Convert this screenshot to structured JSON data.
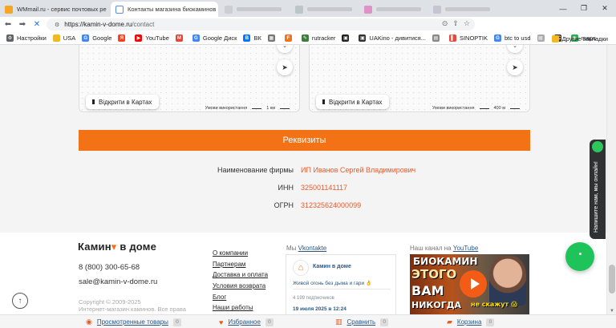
{
  "browser": {
    "tabs": [
      {
        "title": "WMmail.ru - сервис почтовых ре",
        "active": false
      },
      {
        "title": "Контакты магазина биокаминов",
        "active": true
      },
      {
        "title": "",
        "active": false
      },
      {
        "title": "",
        "active": false
      },
      {
        "title": "",
        "active": false
      },
      {
        "title": "",
        "active": false
      }
    ],
    "url_host": "https://kamin-v-dome.ru",
    "url_path": "/contact",
    "window_controls": {
      "minimize": "—",
      "maximize": "❐",
      "close": "✕"
    },
    "bookmarks": [
      "Настройки",
      "USA",
      "Google",
      "",
      "YouTube",
      "",
      "Google Диск",
      "ВК",
      "",
      "",
      "rutracker",
      "",
      "UAKino - дивитися...",
      "",
      "SINOPTIK",
      "btc to usd",
      "",
      "",
      "maps"
    ],
    "other_bookmarks": "Другие закладки"
  },
  "maps": [
    {
      "open_label": "Відкрити в Картах",
      "terms": "Умови використання",
      "scale": "1 км"
    },
    {
      "open_label": "Відкрити в Картах",
      "terms": "Умови використання",
      "scale": "400 м"
    }
  ],
  "requisites": {
    "button_label": "Реквизиты",
    "rows": [
      {
        "key": "Наименование фирмы",
        "value": "ИП Иванов Сергей Владимирович"
      },
      {
        "key": "ИНН",
        "value": "325001141117"
      },
      {
        "key": "ОГРН",
        "value": "312325624000099"
      }
    ]
  },
  "footer": {
    "logo_pre": "Камин",
    "logo_post": " в доме",
    "phone": "8 (800) 300-65-68",
    "email": "sale@kamin-v-dome.ru",
    "copyright_line1": "Copyright © 2009-2025",
    "copyright_line2": "Интернет-магазин каминов. Все права",
    "menu": [
      "О компании",
      "Партнерам",
      "Доставка и оплата",
      "Условия возврата",
      "Блог",
      "Наши работы"
    ],
    "vk_prefix": "Мы ",
    "vk_link": "Vkontakte",
    "vk_group_name": "Камин в доме",
    "vk_slogan": "Живой огонь без дыма и гари 👌",
    "vk_subscribers": "4 199 подписчиков",
    "vk_date": "19 июля 2025 в 12:24",
    "yt_prefix": "Наш канал на ",
    "yt_link": "YouTube",
    "yt_thumb_text": [
      "БИОКАМИН",
      "ЭТОГО",
      "ВАМ",
      "НИКОГДА",
      "не скажут 😱"
    ]
  },
  "chat_widget_label": "Напишите нам, мы онлайн!",
  "bottom_bar": [
    {
      "label": "Просмотренные товары",
      "count": "0"
    },
    {
      "label": "Избранное",
      "count": "0"
    },
    {
      "label": "Сравнить",
      "count": "0"
    },
    {
      "label": "Корзина",
      "count": "0"
    }
  ],
  "colors": {
    "accent": "#f47216",
    "link": "#2a5885",
    "value": "#ea5a2b",
    "online": "#1ec35a"
  }
}
